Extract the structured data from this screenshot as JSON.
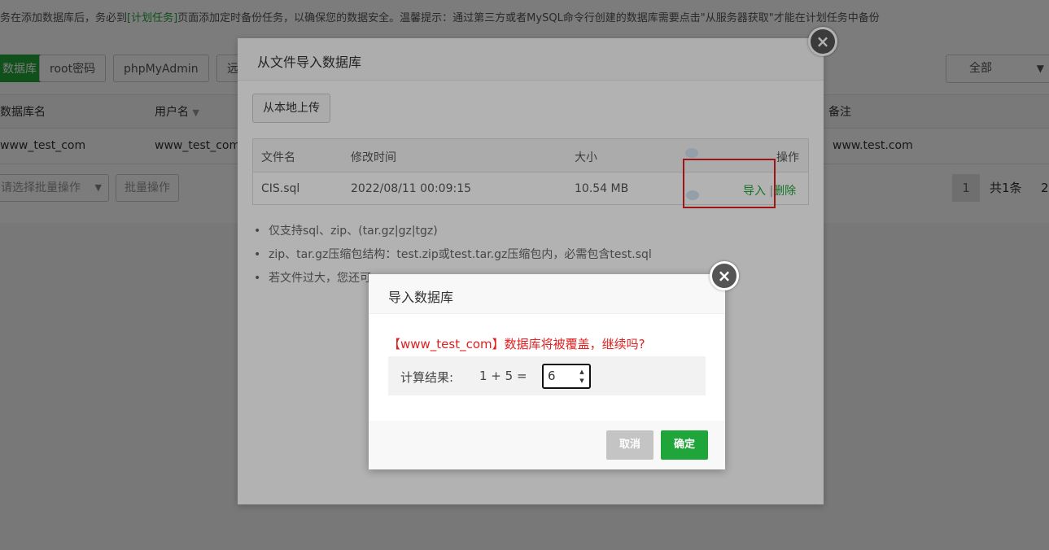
{
  "notice": {
    "prefix": "务在添加数据库后，务必到",
    "link": "[计划任务]",
    "suffix": "页面添加定时备份任务，以确保您的数据安全。温馨提示：通过第三方或者MySQL命令行创建的数据库需要点击\"从服务器获取\"才能在计划任务中备份"
  },
  "toolbar": {
    "add_db": "数据库",
    "root_pwd": "root密码",
    "phpmyadmin": "phpMyAdmin",
    "remote": "远",
    "filter_value": "全部"
  },
  "table": {
    "headers": [
      "数据库名",
      "用户名",
      "备注"
    ],
    "rows": [
      {
        "dbname": "www_test_com",
        "username": "www_test_com",
        "remark": "www.test.com"
      }
    ]
  },
  "batch": {
    "select_placeholder": "请选择批量操作",
    "button": "批量操作"
  },
  "pager": {
    "current": "1",
    "total": "共1条",
    "next": "2"
  },
  "import_modal": {
    "title": "从文件导入数据库",
    "upload_button": "从本地上传",
    "headers": [
      "文件名",
      "修改时间",
      "大小",
      "操作"
    ],
    "files": [
      {
        "name": "CIS.sql",
        "mtime": "2022/08/11 00:09:15",
        "size": "10.54 MB",
        "import": "导入",
        "sep": "|",
        "delete": "删除"
      }
    ],
    "notes": [
      "仅支持sql、zip、(tar.gz|gz|tgz)",
      "zip、tar.gz压缩包结构：test.zip或test.tar.gz压缩包内，必需包含test.sql",
      "若文件过大，您还可"
    ]
  },
  "confirm_modal": {
    "title": "导入数据库",
    "warning": "【www_test_com】数据库将被覆盖，继续吗?",
    "calc_label": "计算结果:",
    "calc_expr": "1 + 5  =",
    "calc_value": "6",
    "cancel": "取消",
    "ok": "确定"
  },
  "colors": {
    "accent": "#20a53a",
    "danger": "#e02020"
  }
}
